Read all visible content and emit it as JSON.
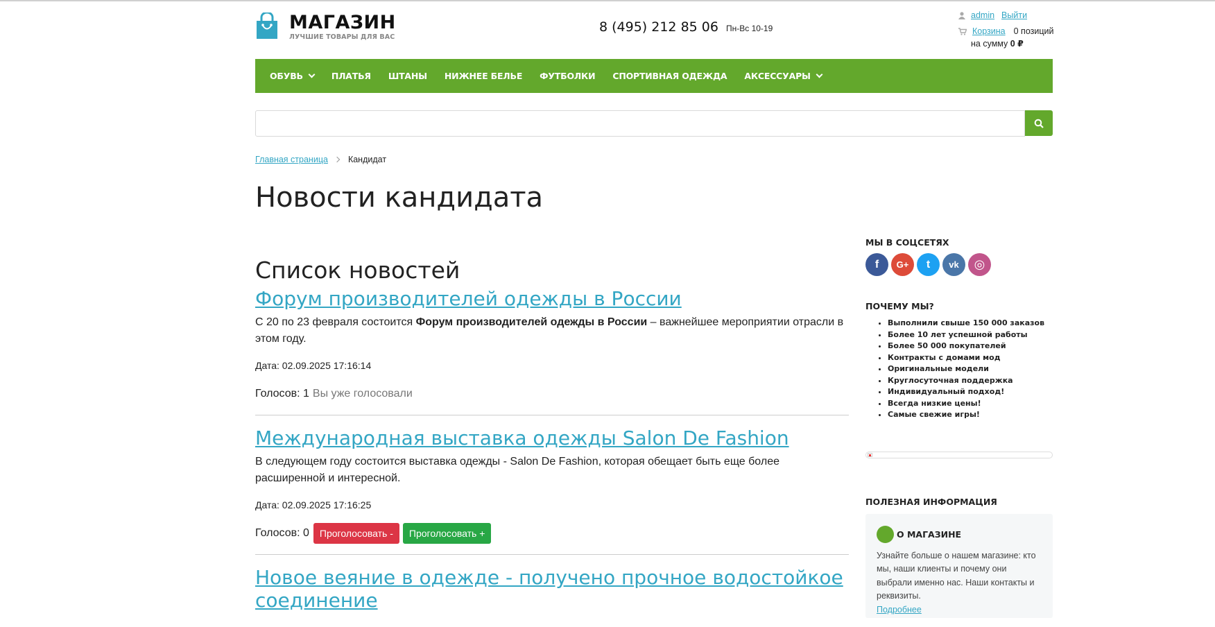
{
  "header": {
    "logo_title": "МАГАЗИН",
    "logo_subtitle": "ЛУЧШИЕ ТОВАРЫ ДЛЯ ВАС",
    "phone": "8 (495) 212 85 06",
    "hours": "Пн-Вс 10-19",
    "user": {
      "name": "admin",
      "logout": "Выйти"
    },
    "cart": {
      "label": "Корзина",
      "count": "0 позиций",
      "sum_prefix": "на сумму",
      "sum_value": "0 ₽"
    }
  },
  "nav": [
    {
      "label": "ОБУВЬ",
      "dropdown": true
    },
    {
      "label": "ПЛАТЬЯ",
      "dropdown": false
    },
    {
      "label": "ШТАНЫ",
      "dropdown": false
    },
    {
      "label": "НИЖНЕЕ БЕЛЬЕ",
      "dropdown": false
    },
    {
      "label": "ФУТБОЛКИ",
      "dropdown": false
    },
    {
      "label": "СПОРТИВНАЯ ОДЕЖДА",
      "dropdown": false
    },
    {
      "label": "АКСЕССУАРЫ",
      "dropdown": true
    }
  ],
  "search": {
    "value": "",
    "placeholder": ""
  },
  "breadcrumb": {
    "home": "Главная страница",
    "current": "Кандидат"
  },
  "page_title": "Новости кандидата",
  "main": {
    "list_title": "Список новостей",
    "news": [
      {
        "title": "Форум производителей одежды в России",
        "text_before": "С 20 по 23 февраля состоится ",
        "text_bold": "Форум производителей одежды в России",
        "text_after": " – важнейшее мероприятии отрасли в этом году.",
        "date": "Дата: 02.09.2025 17:16:14",
        "votes": "Голосов: 1",
        "voted": "Вы уже голосовали"
      },
      {
        "title": "Международная выставка одежды Salon De Fashion",
        "text": "В следующем году состоится выставка одежды - Salon De Fashion, которая обещает быть еще более расширенной и интересной.",
        "date": "Дата: 02.09.2025 17:16:25",
        "votes": "Голосов: 0",
        "vote_minus": "Проголосовать -",
        "vote_plus": "Проголосовать +"
      },
      {
        "title": "Новое веяние в одежде - получено прочное водостойкое соединение"
      }
    ]
  },
  "sidebar": {
    "social_title": "МЫ В СОЦСЕТЯХ",
    "social": [
      {
        "icon": "facebook-icon",
        "glyph": "f",
        "color": "#3b5998"
      },
      {
        "icon": "google-plus-icon",
        "glyph": "G+",
        "color": "#dd4b39"
      },
      {
        "icon": "twitter-icon",
        "glyph": "t",
        "color": "#1da1f2"
      },
      {
        "icon": "vk-icon",
        "glyph": "vk",
        "color": "#4a76a8"
      },
      {
        "icon": "instagram-icon",
        "glyph": "◎",
        "color": "#c1558b"
      }
    ],
    "why_title": "ПОЧЕМУ МЫ?",
    "why_items": [
      "Выполнили свыше 150 000 заказов",
      "Более 10 лет успешной работы",
      "Более 50 000 покупателей",
      "Контракты с домами мод",
      "Оригинальные модели",
      "Круглосуточная поддержка",
      "Индивидуальный подход!",
      "Всегда низкие цены!",
      "Самые свежие игры!"
    ],
    "useful_title": "ПОЛЕЗНАЯ ИНФОРМАЦИЯ",
    "info": {
      "title": "О МАГАЗИНЕ",
      "text": "Узнайте больше о нашем магазине: кто мы, наши клиенты и почему они выбрали именно нас. Наши контакты и реквизиты.",
      "more": "Подробнее"
    }
  },
  "colors": {
    "accent": "#63a82c",
    "link": "#33a6c4",
    "vote_minus": "#dc3545",
    "vote_plus": "#28a745"
  }
}
